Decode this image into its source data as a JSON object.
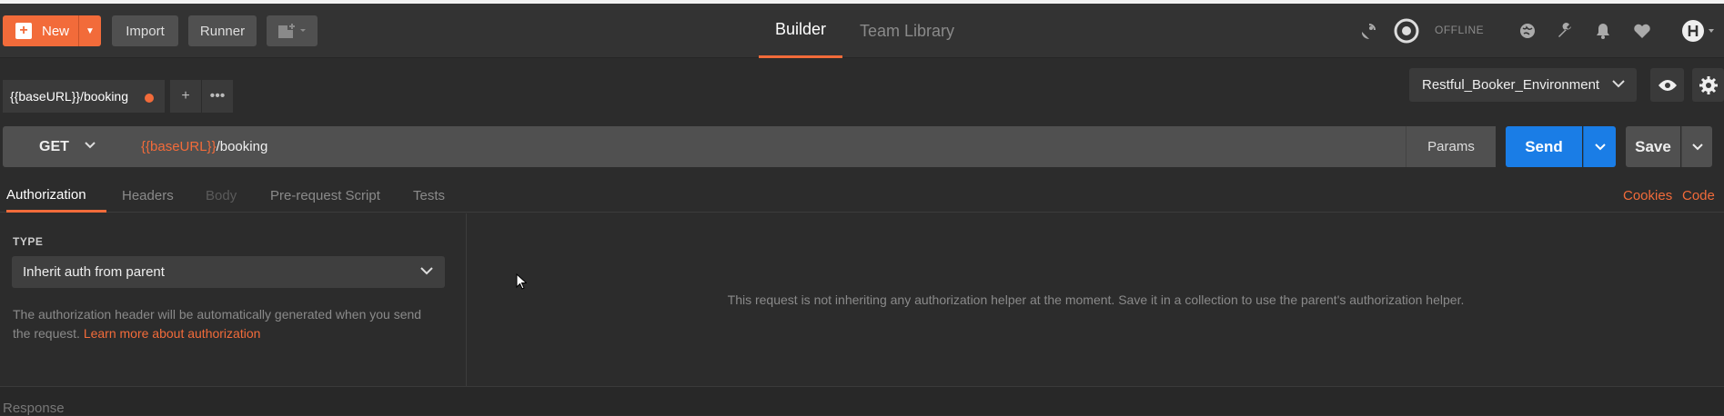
{
  "colors": {
    "accent": "#f26b3a",
    "send": "#1a7de6",
    "background": "#2c2c2c"
  },
  "header": {
    "new_label": "New",
    "import_label": "Import",
    "runner_label": "Runner",
    "tabs": [
      {
        "label": "Builder",
        "active": true
      },
      {
        "label": "Team Library",
        "active": false
      }
    ],
    "status_label": "OFFLINE",
    "icons": [
      "satellite-icon",
      "sync-icon",
      "globe-icon",
      "wrench-icon",
      "bell-icon",
      "heart-icon",
      "user-avatar-icon"
    ]
  },
  "request_tab": {
    "label": "{{baseURL}}/booking",
    "unsaved": true
  },
  "environment": {
    "selected": "Restful_Booker_Environment"
  },
  "request": {
    "method": "GET",
    "url_var": "{{baseURL}}",
    "url_path": "/booking",
    "params_label": "Params",
    "send_label": "Send",
    "save_label": "Save"
  },
  "subtabs": [
    {
      "label": "Authorization",
      "state": "active"
    },
    {
      "label": "Headers",
      "state": "normal"
    },
    {
      "label": "Body",
      "state": "disabled"
    },
    {
      "label": "Pre-request Script",
      "state": "normal"
    },
    {
      "label": "Tests",
      "state": "normal"
    }
  ],
  "links": {
    "cookies": "Cookies",
    "code": "Code"
  },
  "auth": {
    "type_label": "TYPE",
    "type_value": "Inherit auth from parent",
    "description": "The authorization header will be automatically generated when you send the request. ",
    "learn_more": "Learn more about authorization"
  },
  "message": "This request is not inheriting any authorization helper at the moment. Save it in a collection to use the parent's authorization helper.",
  "response_label": "Response"
}
